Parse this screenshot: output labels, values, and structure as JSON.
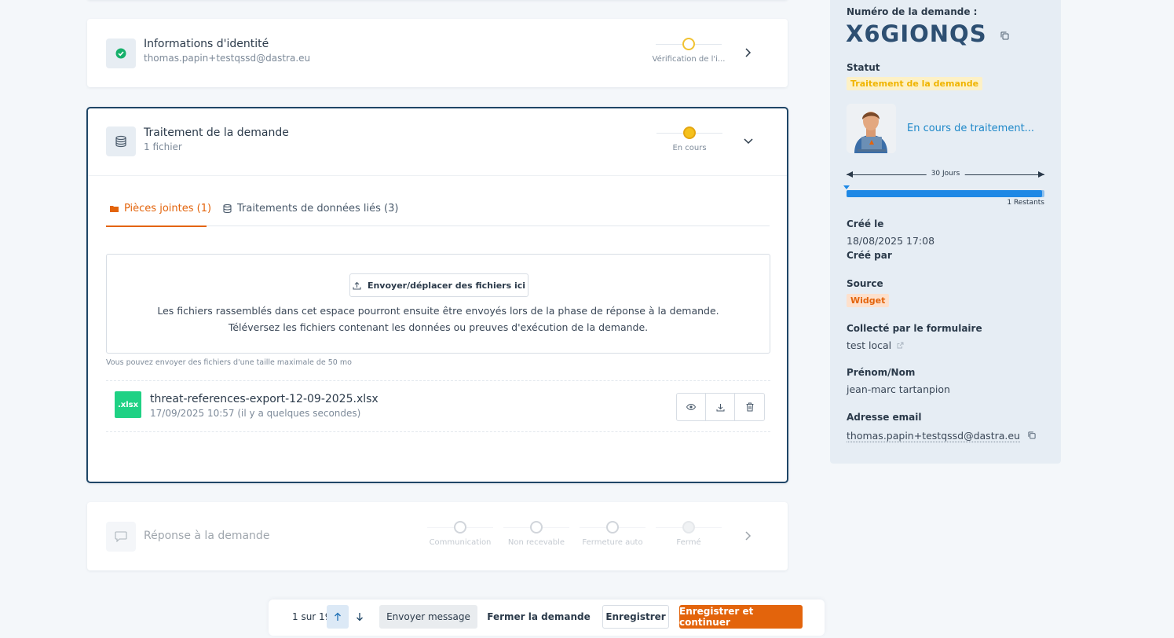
{
  "identity_step": {
    "title": "Informations d'identité",
    "subtitle": "thomas.papin+testqssd@dastra.eu",
    "stage_label": "Vérification de l'i..."
  },
  "processing_step": {
    "title": "Traitement de la demande",
    "subtitle": "1 fichier",
    "stage_label": "En cours",
    "tabs": [
      {
        "label": "Pièces jointes (1)",
        "active": true
      },
      {
        "label": "Traitements de données liés (3)",
        "active": false
      }
    ],
    "upload_button": "Envoyer/déplacer des fichiers ici",
    "dropzone_text": "Les fichiers rassemblés dans cet espace pourront ensuite être envoyés lors de la phase de réponse à la demande. Téléversez les fichiers contenant les données ou preuves d'exécution de la demande.",
    "size_note": "Vous pouvez envoyer des fichiers d'une taille maximale de 50 mo",
    "file": {
      "badge": ".xlsx",
      "name": "threat-references-export-12-09-2025.xlsx",
      "date": "17/09/2025 10:57 (il y a quelques secondes)"
    }
  },
  "response_step": {
    "title": "Réponse à la demande",
    "stages": [
      "Communication",
      "Non recevable",
      "Fermeture auto",
      "Fermé"
    ]
  },
  "sidebar": {
    "number_label": "Numéro de la demande :",
    "number": "X6GIONQS",
    "status_label": "Statut",
    "status_value": "Traitement de la demande",
    "progress_status": "En cours de traitement...",
    "timeline_label": "30 Jours",
    "remaining_label": "1 Restants",
    "progress_fraction": 0.99,
    "created_label": "Créé le",
    "created_value": "18/08/2025 17:08",
    "created_by_label": "Créé par",
    "source_label": "Source",
    "source_value": "Widget",
    "form_label": "Collecté par le formulaire",
    "form_value": "test local",
    "name_label": "Prénom/Nom",
    "name_value": "jean-marc tartanpion",
    "email_label": "Adresse email",
    "email_value": "thomas.papin+testqssd@dastra.eu"
  },
  "bottom_bar": {
    "pager": "1 sur 19",
    "send_message": "Envoyer message",
    "close_request": "Fermer la demande",
    "save": "Enregistrer",
    "save_continue": "Enregistrer et continuer"
  },
  "colors": {
    "accent_orange": "#e3640c",
    "status_yellow": "#f5c11c",
    "link_blue": "#1e88c9",
    "file_green": "#1fd184",
    "navy": "#1f4667"
  }
}
